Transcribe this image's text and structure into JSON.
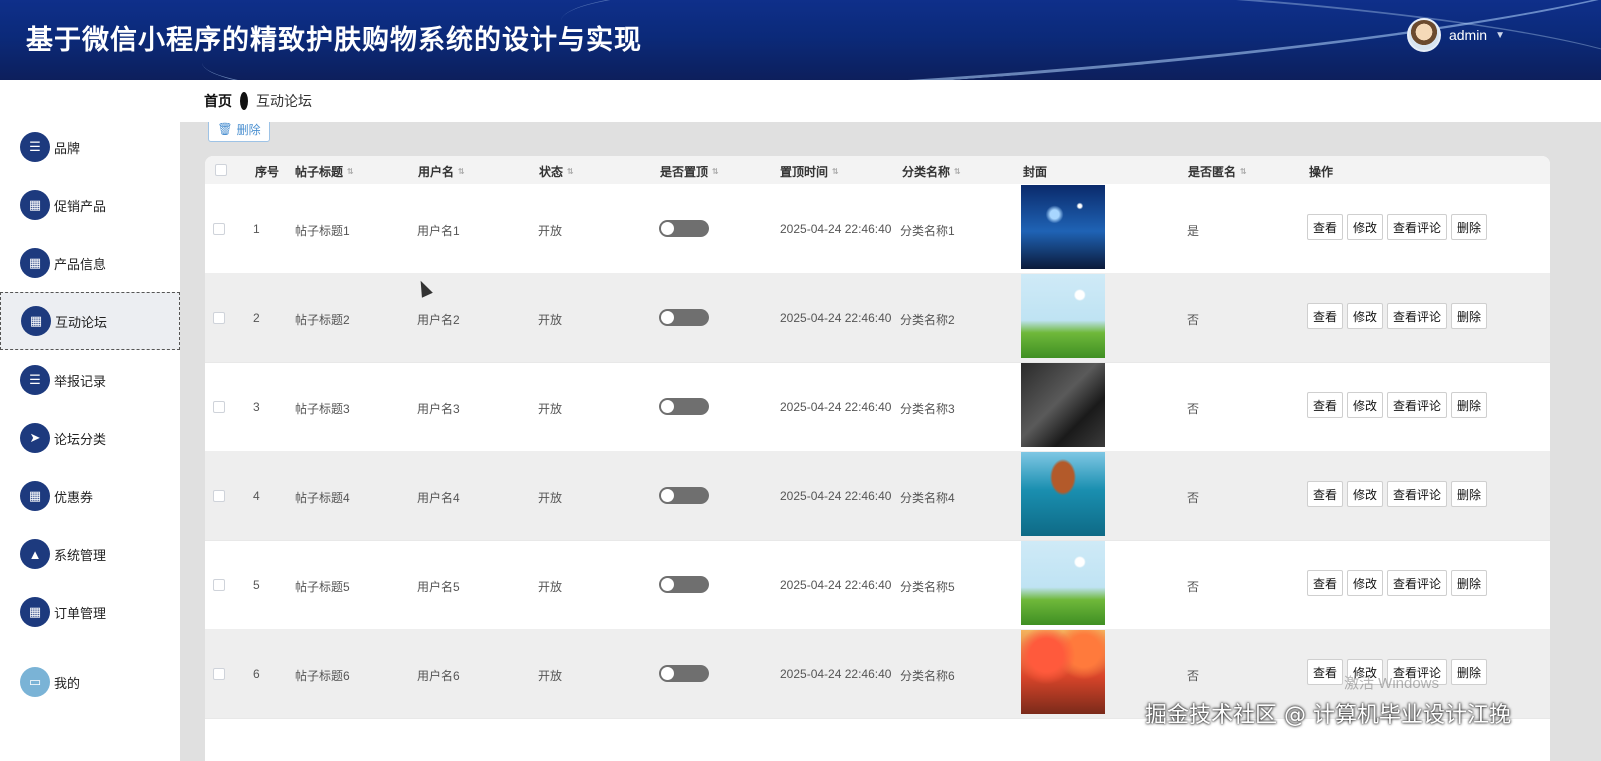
{
  "header": {
    "title": "基于微信小程序的精致护肤购物系统的设计与实现",
    "username": "admin"
  },
  "breadcrumb": {
    "home": "首页",
    "current": "互动论坛"
  },
  "sidebar": {
    "items": [
      {
        "label": "品牌",
        "icon": "list-icon"
      },
      {
        "label": "促销产品",
        "icon": "grid-icon"
      },
      {
        "label": "产品信息",
        "icon": "grid-icon"
      },
      {
        "label": "互动论坛",
        "icon": "grid-icon",
        "active": true
      },
      {
        "label": "举报记录",
        "icon": "list-icon"
      },
      {
        "label": "论坛分类",
        "icon": "send-icon"
      },
      {
        "label": "优惠券",
        "icon": "grid-icon"
      },
      {
        "label": "系统管理",
        "icon": "chart-icon"
      },
      {
        "label": "订单管理",
        "icon": "grid-icon"
      },
      {
        "label": "我的",
        "icon": "card-icon"
      }
    ]
  },
  "toolbar": {
    "delete_label": "删除"
  },
  "table": {
    "columns": [
      "序号",
      "帖子标题",
      "用户名",
      "状态",
      "是否置顶",
      "置顶时间",
      "分类名称",
      "封面",
      "是否匿名",
      "操作"
    ],
    "rows": [
      {
        "index": "1",
        "title": "帖子标题1",
        "user": "用户名1",
        "status": "开放",
        "time": "2025-04-24 22:46:40",
        "category": "分类名称1",
        "anonymous": "是",
        "cover": "night-sky"
      },
      {
        "index": "2",
        "title": "帖子标题2",
        "user": "用户名2",
        "status": "开放",
        "time": "2025-04-24 22:46:40",
        "category": "分类名称2",
        "anonymous": "否",
        "cover": "meadow"
      },
      {
        "index": "3",
        "title": "帖子标题3",
        "user": "用户名3",
        "status": "开放",
        "time": "2025-04-24 22:46:40",
        "category": "分类名称3",
        "anonymous": "否",
        "cover": "book"
      },
      {
        "index": "4",
        "title": "帖子标题4",
        "user": "用户名4",
        "status": "开放",
        "time": "2025-04-24 22:46:40",
        "category": "分类名称4",
        "anonymous": "否",
        "cover": "sea-arch"
      },
      {
        "index": "5",
        "title": "帖子标题5",
        "user": "用户名5",
        "status": "开放",
        "time": "2025-04-24 22:46:40",
        "category": "分类名称5",
        "anonymous": "否",
        "cover": "meadow"
      },
      {
        "index": "6",
        "title": "帖子标题6",
        "user": "用户名6",
        "status": "开放",
        "time": "2025-04-24 22:46:40",
        "category": "分类名称6",
        "anonymous": "否",
        "cover": "autumn"
      }
    ],
    "actions": [
      "查看",
      "修改",
      "查看评论",
      "删除"
    ]
  },
  "watermarks": {
    "windows": "激活 Windows",
    "site": "掘金技术社区 @ 计算机毕业设计江挽"
  },
  "colors": {
    "header": "#0b2a7a",
    "menu_icon": "#1d3a7e",
    "switch_off": "#6f6f6f"
  }
}
